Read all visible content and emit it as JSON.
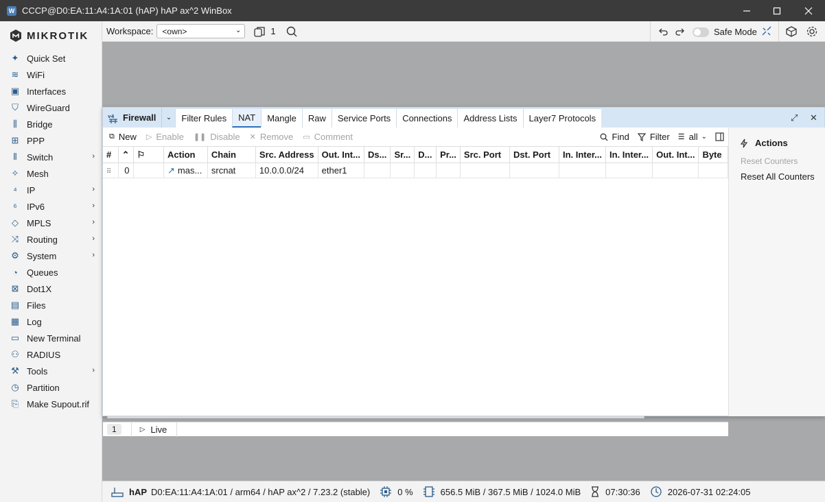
{
  "window": {
    "title": "CCCP@D0:EA:11:A4:1A:01 (hAP) hAP ax^2 WinBox",
    "minimize": "–",
    "maximize": "☐",
    "close": "✕"
  },
  "logo": {
    "text": "MIKROTIK"
  },
  "sidebar": {
    "items": [
      {
        "label": "Quick Set",
        "icon": "wand-icon",
        "arrow": ""
      },
      {
        "label": "WiFi",
        "icon": "wifi-icon",
        "arrow": ""
      },
      {
        "label": "Interfaces",
        "icon": "interfaces-icon",
        "arrow": ""
      },
      {
        "label": "WireGuard",
        "icon": "shield-icon",
        "arrow": ""
      },
      {
        "label": "Bridge",
        "icon": "bridge-icon",
        "arrow": ""
      },
      {
        "label": "PPP",
        "icon": "ppp-icon",
        "arrow": ""
      },
      {
        "label": "Switch",
        "icon": "switch-icon",
        "arrow": "›"
      },
      {
        "label": "Mesh",
        "icon": "mesh-icon",
        "arrow": ""
      },
      {
        "label": "IP",
        "icon": "ipv4-icon",
        "arrow": "›"
      },
      {
        "label": "IPv6",
        "icon": "ipv6-icon",
        "arrow": "›"
      },
      {
        "label": "MPLS",
        "icon": "tag-icon",
        "arrow": "›"
      },
      {
        "label": "Routing",
        "icon": "routing-icon",
        "arrow": "›"
      },
      {
        "label": "System",
        "icon": "gear-icon",
        "arrow": "›"
      },
      {
        "label": "Queues",
        "icon": "queues-icon",
        "arrow": ""
      },
      {
        "label": "Dot1X",
        "icon": "dot1x-icon",
        "arrow": ""
      },
      {
        "label": "Files",
        "icon": "files-icon",
        "arrow": ""
      },
      {
        "label": "Log",
        "icon": "log-icon",
        "arrow": ""
      },
      {
        "label": "New Terminal",
        "icon": "terminal-icon",
        "arrow": ""
      },
      {
        "label": "RADIUS",
        "icon": "radius-icon",
        "arrow": ""
      },
      {
        "label": "Tools",
        "icon": "tools-icon",
        "arrow": "›"
      },
      {
        "label": "Partition",
        "icon": "partition-icon",
        "arrow": ""
      },
      {
        "label": "Make Supout.rif",
        "icon": "supout-icon",
        "arrow": ""
      }
    ]
  },
  "toolbar": {
    "workspace_label": "Workspace:",
    "workspace_value": "<own>",
    "windows_count": "1",
    "safe_mode": "Safe Mode"
  },
  "firewall": {
    "title": "Firewall",
    "tabs": [
      "Filter Rules",
      "NAT",
      "Mangle",
      "Raw",
      "Service Ports",
      "Connections",
      "Address Lists",
      "Layer7 Protocols"
    ],
    "active_tab": "NAT",
    "actions": {
      "new": "New",
      "enable": "Enable",
      "disable": "Disable",
      "remove": "Remove",
      "comment": "Comment",
      "find": "Find",
      "filter": "Filter",
      "filter_value": "all"
    },
    "columns": [
      "#",
      "",
      "",
      "Action",
      "Chain",
      "Src. Address",
      "Out. Int...",
      "Ds...",
      "Sr...",
      "D...",
      "Pr...",
      "Src. Port",
      "Dst. Port",
      "In. Inter...",
      "In. Inter...",
      "Out. Int...",
      "Byte"
    ],
    "rows": [
      [
        "",
        "0",
        "",
        "mas...",
        "srcnat",
        "10.0.0.0/24",
        "ether1",
        "",
        "",
        "",
        "",
        "",
        "",
        "",
        "",
        "",
        ""
      ]
    ],
    "row_count": "1",
    "live": "Live",
    "side_panel": {
      "title": "Actions",
      "reset_counters": "Reset Counters",
      "reset_all_counters": "Reset All Counters"
    }
  },
  "statusbar": {
    "device": "hAP",
    "info": "D0:EA:11:A4:1A:01 / arm64 / hAP ax^2 / 7.23.2 (stable)",
    "cpu": "0 %",
    "memory": "656.5 MiB / 367.5 MiB / 1024.0 MiB",
    "uptime": "07:30:36",
    "datetime": "2026-07-31 02:24:05"
  },
  "colors": {
    "accent": "#2a6fb8",
    "icon": "#2a5c8a",
    "window_header": "#d7e6f5",
    "workspace_bg": "#a8a9aa"
  }
}
